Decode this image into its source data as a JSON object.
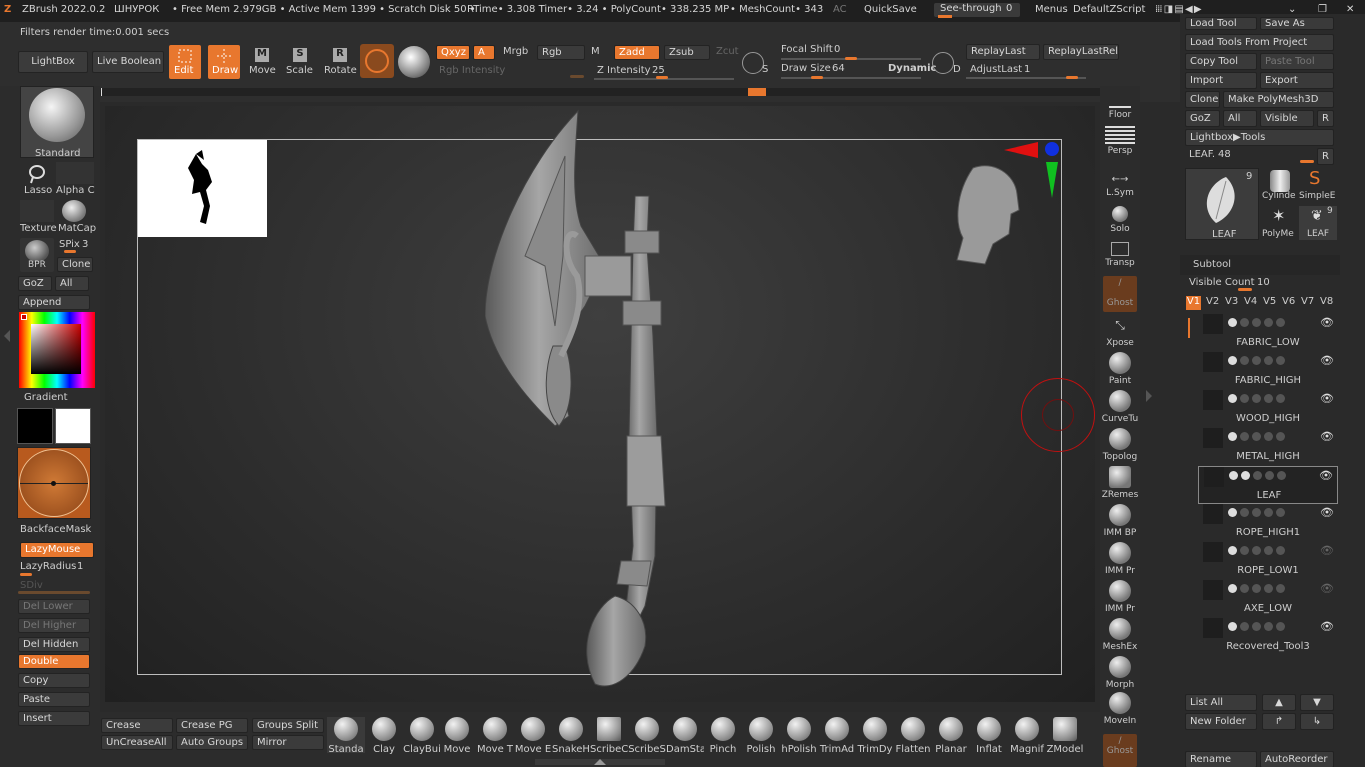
{
  "titlebar": {
    "app": "ZBrush 2022.0.2",
    "doc": "ШНУРОК",
    "stats": "• Free Mem 2.979GB • Active Mem 1399 • Scratch Disk 50 •",
    "rtime": "RTime• 3.308 Timer• 3.24 • PolyCount• 338.235 MP",
    "mesh": "• MeshCount• 343",
    "ac": "AC",
    "quicksave": "QuickSave",
    "seethrough": "See-through",
    "seethrough_val": "0",
    "menus": "Menus",
    "script": "DefaultZScript"
  },
  "status": "Filters render time:0.001 secs",
  "top": {
    "lightbox": "LightBox",
    "liveboolean": "Live Boolean",
    "edit": "Edit",
    "draw": "Draw",
    "move": "Move",
    "scale": "Scale",
    "rotate": "Rotate",
    "xyz": "Qxyz",
    "a": "A",
    "mrgb": "Mrgb",
    "rgb": "Rgb",
    "m": "M",
    "zadd": "Zadd",
    "zsub": "Zsub",
    "zcut": "Zcut",
    "rgb_intensity": "Rgb Intensity",
    "z_intensity": "Z Intensity",
    "z_intensity_val": "25",
    "focal": "Focal Shift",
    "focal_val": "0",
    "drawsize": "Draw Size",
    "drawsize_val": "64",
    "dynamic": "Dynamic",
    "s": "S",
    "d": "D",
    "replaylast": "ReplayLast",
    "replaylastrel": "ReplayLastRel",
    "adjustlast": "AdjustLast",
    "adjustlast_val": "1"
  },
  "left": {
    "brush": "Standard",
    "lasso": "Lasso",
    "alpha": "Alpha C",
    "texture": "Texture",
    "matcap": "MatCap",
    "bpr": "BPR",
    "spix": "SPix",
    "spix_val": "3",
    "clone": "Clone",
    "goz": "GoZ",
    "all": "All",
    "append": "Append",
    "gradient": "Gradient",
    "backface": "BackfaceMask",
    "lazymouse": "LazyMouse",
    "lazyradius": "LazyRadius",
    "lazyradius_val": "1",
    "sdiv": "SDiv",
    "dellower": "Del Lower",
    "delhigher": "Del Higher",
    "delhidden": "Del Hidden",
    "double": "Double",
    "copy": "Copy",
    "paste": "Paste",
    "insert": "Insert"
  },
  "shelf": [
    "Floor",
    "Persp",
    "L.Sym",
    "Solo",
    "Transp",
    "Ghost",
    "Xpose",
    "Paint",
    "CurveTu",
    "Topolog",
    "ZRemes",
    "IMM BP",
    "IMM Pr",
    "IMM Pr",
    "MeshEx",
    "Morph",
    "MoveIn",
    "Ghost"
  ],
  "right": {
    "loadtool": "Load Tool",
    "saveas": "Save As",
    "loadproject": "Load Tools From Project",
    "copytool": "Copy Tool",
    "pastetool": "Paste Tool",
    "import": "Import",
    "export": "Export",
    "clone": "Clone",
    "makepolymesh": "Make PolyMesh3D",
    "goz": "GoZ",
    "all": "All",
    "visible": "Visible",
    "r": "R",
    "lightboxtools": "Lightbox▶Tools",
    "leaf_label": "LEAF.",
    "leaf_val": "48",
    "thumb_main": "LEAF",
    "thumb_count": "9",
    "cylinder": "Cylinde",
    "simple": "SimpleE",
    "polymesh": "PolyMe",
    "leaf2": "LEAF",
    "leaf2_count": "9",
    "subtool": "Subtool",
    "visiblecount": "Visible Count",
    "visiblecount_val": "10",
    "versions": [
      "V1",
      "V2",
      "V3",
      "V4",
      "V5",
      "V6",
      "V7",
      "V8"
    ],
    "subtools": [
      "FABRIC_LOW",
      "FABRIC_HIGH",
      "WOOD_HIGH",
      "METAL_HIGH",
      "LEAF",
      "ROPE_HIGH1",
      "ROPE_LOW1",
      "AXE_LOW",
      "Recovered_Tool3"
    ],
    "listall": "List All",
    "newfolder": "New Folder",
    "rename": "Rename",
    "autoreorder": "AutoReorder"
  },
  "bottom": {
    "crease": "Crease",
    "creasepg": "Crease PG",
    "groupssplit": "Groups Split",
    "uncreaseall": "UnCreaseAll",
    "autogroups": "Auto Groups",
    "mirror": "Mirror",
    "brushes": [
      "Standa",
      "Clay",
      "ClayBui",
      "Move",
      "Move T",
      "Move E",
      "SnakeH",
      "ScribeC",
      "ScribeS",
      "DamSta",
      "Pinch",
      "Polish",
      "hPolish",
      "TrimAd",
      "TrimDy",
      "Flatten",
      "Planar",
      "Inflat",
      "Magnif",
      "ZModel"
    ]
  },
  "colors": {
    "accent": "#e8772e",
    "bg": "#2a2a2a",
    "gizmo_red": "#e01010",
    "gizmo_green": "#10c020",
    "gizmo_blue": "#1030e0"
  }
}
